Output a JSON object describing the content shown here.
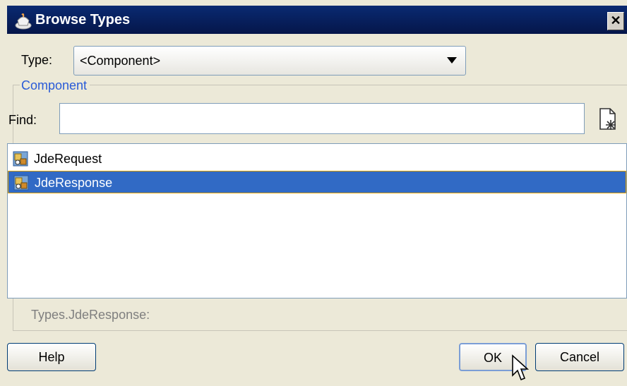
{
  "window": {
    "title": "Browse Types",
    "close_glyph": "✕"
  },
  "type_row": {
    "label": "Type:",
    "selected": "<Component>"
  },
  "component_group": {
    "legend": "Component"
  },
  "find": {
    "label": "Find:",
    "value": ""
  },
  "list": {
    "items": [
      {
        "label": "JdeRequest",
        "icon": "component-type-icon",
        "selected": false
      },
      {
        "label": "JdeResponse",
        "icon": "component-type-icon",
        "selected": true
      }
    ]
  },
  "status_text": "Types.JdeResponse:",
  "buttons": {
    "help": "Help",
    "ok": "OK",
    "cancel": "Cancel"
  },
  "colors": {
    "title_bar": "#0a2a72",
    "selection": "#316ac5",
    "legend": "#2a5bd7"
  }
}
